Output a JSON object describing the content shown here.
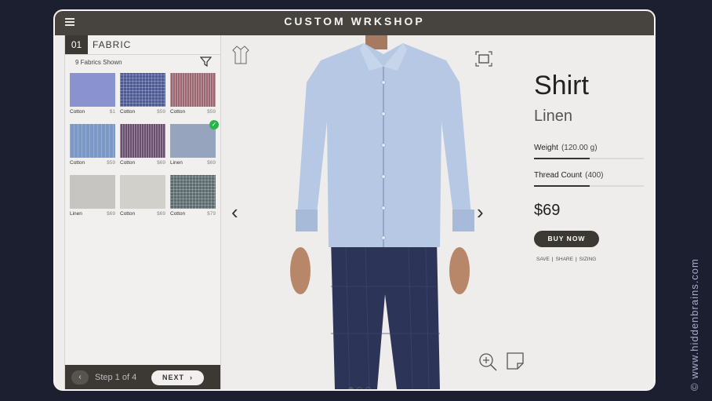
{
  "app": {
    "title": "CUSTOM WRKSHOP"
  },
  "step": {
    "number": "01",
    "label": "FABRIC",
    "fabric_count": "9 Fabrics Shown"
  },
  "swatches": [
    {
      "name": "Cotton",
      "price": "$1",
      "color": "#8a93cf",
      "pattern": "plain"
    },
    {
      "name": "Cotton",
      "price": "$59",
      "color": "#4d5a8f",
      "pattern": "check"
    },
    {
      "name": "Cotton",
      "price": "$59",
      "color": "#9a6670",
      "pattern": "stripe"
    },
    {
      "name": "Cotton",
      "price": "$59",
      "color": "#7c98c6",
      "pattern": "stripe-thin"
    },
    {
      "name": "Cotton",
      "price": "$69",
      "color": "#6a4e6e",
      "pattern": "stripe"
    },
    {
      "name": "Linen",
      "price": "$69",
      "color": "#97a4bd",
      "pattern": "plain",
      "selected": true
    },
    {
      "name": "Linen",
      "price": "$69",
      "color": "#c7c5c1",
      "pattern": "plain"
    },
    {
      "name": "Cotton",
      "price": "$69",
      "color": "#d2d0cb",
      "pattern": "plain"
    },
    {
      "name": "Cotton",
      "price": "$79",
      "color": "#5d6a6e",
      "pattern": "check"
    }
  ],
  "footer": {
    "prev_icon": "chevron-left",
    "step_text": "Step 1 of 4",
    "next_label": "NEXT",
    "next_icon": "chevron-right"
  },
  "viewer": {
    "prev_arrow": "‹",
    "next_arrow": "›",
    "dots": 3,
    "active_dot": 0
  },
  "product": {
    "name": "Shirt",
    "fabric": "Linen",
    "weight_label": "Weight",
    "weight_value": "(120.00 g)",
    "weight_fill": 0.51,
    "thread_label": "Thread Count",
    "thread_value": "(400)",
    "thread_fill": 0.51,
    "price": "$69",
    "buy_label": "BUY NOW",
    "links": [
      "SAVE",
      "SHARE",
      "SIZING"
    ]
  },
  "colors": {
    "shirt": "#b6c8e3",
    "pants": "#2c3458",
    "skin": "#b8876a"
  },
  "watermark": "© www.hiddenbrains.com"
}
